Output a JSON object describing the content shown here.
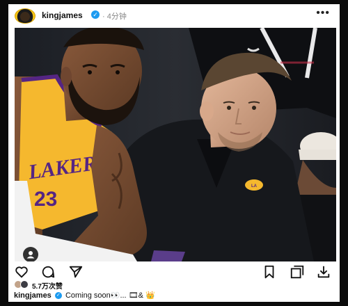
{
  "post": {
    "username": "kingjames",
    "timestamp": "· 4分钟",
    "more_label": "•••"
  },
  "photo": {
    "jersey_text": "LAKERS",
    "jersey_number": "23"
  },
  "engagement": {
    "likes": "5.7万次赞"
  },
  "caption": {
    "username": "kingjames",
    "text": "Coming soon👀... 🎞& 👑"
  },
  "colors": {
    "lakers_gold": "#f5b82e",
    "lakers_purple": "#552583",
    "verified_blue": "#1d9bf0"
  },
  "icons": [
    "heart-icon",
    "comment-icon",
    "share-icon",
    "bookmark-icon",
    "repost-icon",
    "download-icon"
  ]
}
